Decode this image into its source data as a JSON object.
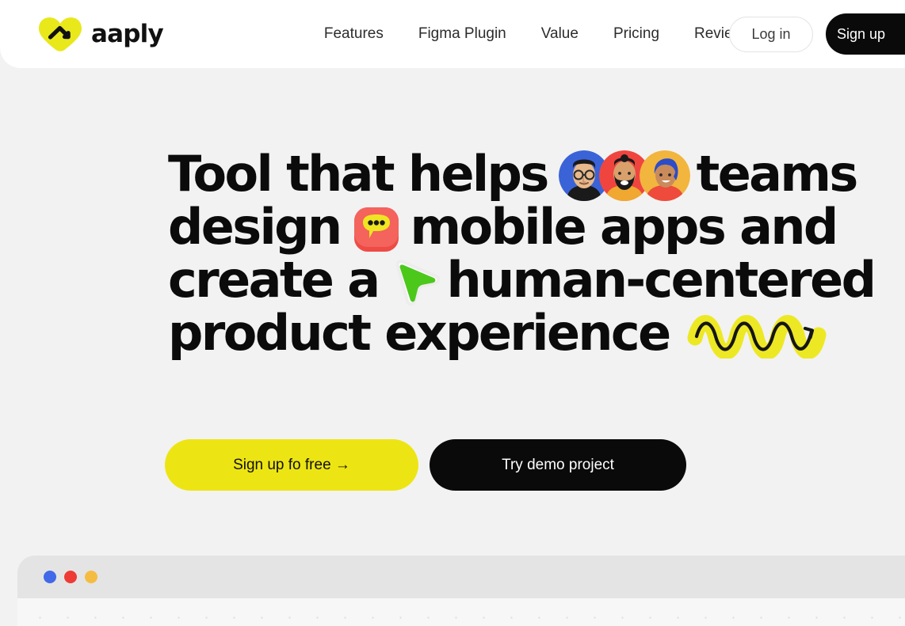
{
  "brand": {
    "name": "aaply",
    "logo_icon": "chevron-arrow-heart-logo",
    "logo_bg": "#E9E81B",
    "logo_stroke": "#111111"
  },
  "nav": {
    "items": [
      {
        "label": "Features"
      },
      {
        "label": "Figma Plugin"
      },
      {
        "label": "Value"
      },
      {
        "label": "Pricing"
      },
      {
        "label": "Reviews"
      }
    ]
  },
  "header_actions": {
    "login_label": "Log in",
    "signup_label": "Sign up",
    "login_bg": "#FFFFFF",
    "signup_bg": "#0A0A0A"
  },
  "hero": {
    "headline": {
      "line1_a": "Tool that helps",
      "line1_b": "teams",
      "line2_a": "design",
      "line2_b": "mobile apps and",
      "line3_a": "create a",
      "line3_b": "human-centered",
      "line4_a": "product experience"
    },
    "decorations": {
      "avatars_icon": "team-avatars-icon",
      "chat_icon": "chat-bubble-icon",
      "cursor_icon": "green-cursor-icon",
      "squiggle_icon": "yellow-squiggle-icon"
    },
    "cta": {
      "primary_label": "Sign up fo free →",
      "secondary_label": "Try demo project",
      "primary_bg": "#EDE513",
      "secondary_bg": "#0A0A0A"
    }
  },
  "browser_mockup": {
    "dots": [
      {
        "name": "browser-dot-blue",
        "color": "#4169E8"
      },
      {
        "name": "browser-dot-red",
        "color": "#EE3B36"
      },
      {
        "name": "browser-dot-yellow",
        "color": "#F5BC42"
      }
    ],
    "chrome_bg": "#E4E4E4",
    "canvas_bg": "#F7F7F7"
  },
  "page": {
    "background": "#F2F2F2"
  }
}
